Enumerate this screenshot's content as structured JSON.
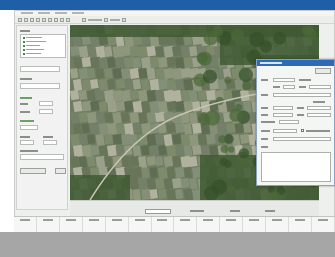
{
  "window": {
    "title": ""
  },
  "menu": {
    "items": [
      "",
      "",
      "",
      ""
    ]
  },
  "toolbar": {
    "buttons": [
      "",
      "",
      "",
      "",
      "",
      "",
      "",
      "",
      "",
      "",
      "",
      "",
      "",
      ""
    ]
  },
  "left_panel": {
    "layers_label": "",
    "layers": [
      "",
      "",
      "",
      "",
      "",
      ""
    ],
    "field_labels": [
      "",
      "",
      "",
      "",
      "",
      "",
      "",
      ""
    ],
    "button_labels": [
      "",
      ""
    ]
  },
  "map": {
    "scale_value": "",
    "coordinates": [
      "",
      "",
      ""
    ]
  },
  "dialog": {
    "title": "",
    "button_label": "",
    "field_labels": [
      "",
      "",
      "",
      "",
      "",
      "",
      "",
      "",
      "",
      "",
      "",
      "",
      "",
      ""
    ],
    "checkbox_label": ""
  },
  "status_table": {
    "columns": [
      "",
      "",
      "",
      "",
      "",
      "",
      "",
      "",
      "",
      "",
      "",
      "",
      "",
      ""
    ]
  },
  "colors": {
    "title_bar": "#1f5fa8",
    "dialog_title": "#2d6bb8",
    "map_base": "#6f7d60",
    "forest": "#3f5a32",
    "footer": "#a6a6a6"
  }
}
